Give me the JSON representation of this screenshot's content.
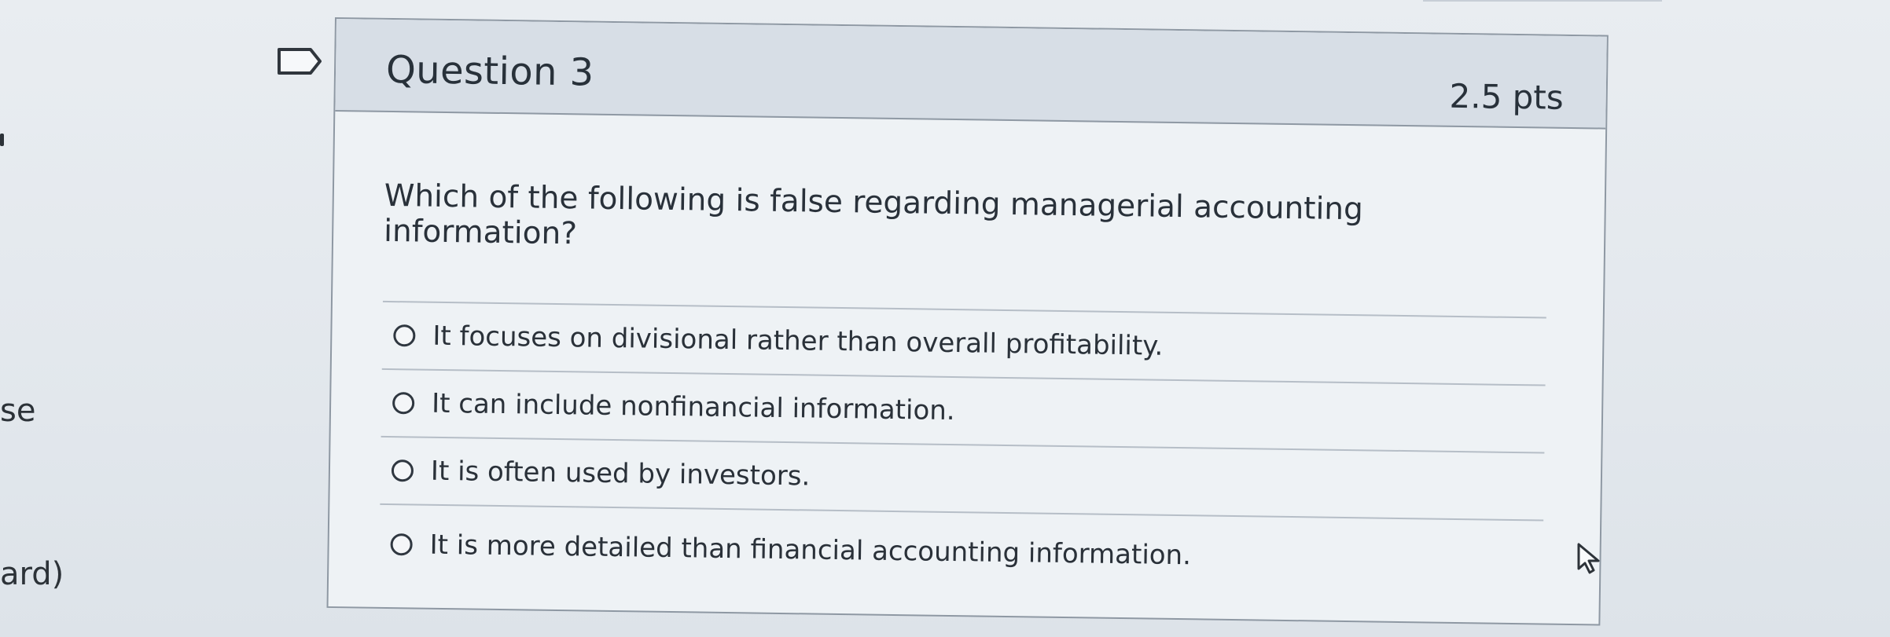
{
  "left_fragments": {
    "line1": "se",
    "line2": "ard)"
  },
  "question": {
    "title": "Question 3",
    "points": "2.5 pts",
    "prompt": "Which of the following is false regarding managerial accounting information?",
    "options": [
      {
        "label": "It focuses on divisional rather than overall proﬁtability."
      },
      {
        "label": "It can include nonﬁnancial information."
      },
      {
        "label": "It is often used by investors."
      },
      {
        "label": "It is more detailed than ﬁnancial accounting information."
      }
    ]
  },
  "icons": {
    "flag": "flag-icon",
    "radio": "radio-button-icon",
    "cursor": "mouse-pointer-icon"
  },
  "colors": {
    "background": "#e3e8ed",
    "header": "#d7dee6",
    "text": "#2b3138",
    "border": "#8e98a3"
  }
}
